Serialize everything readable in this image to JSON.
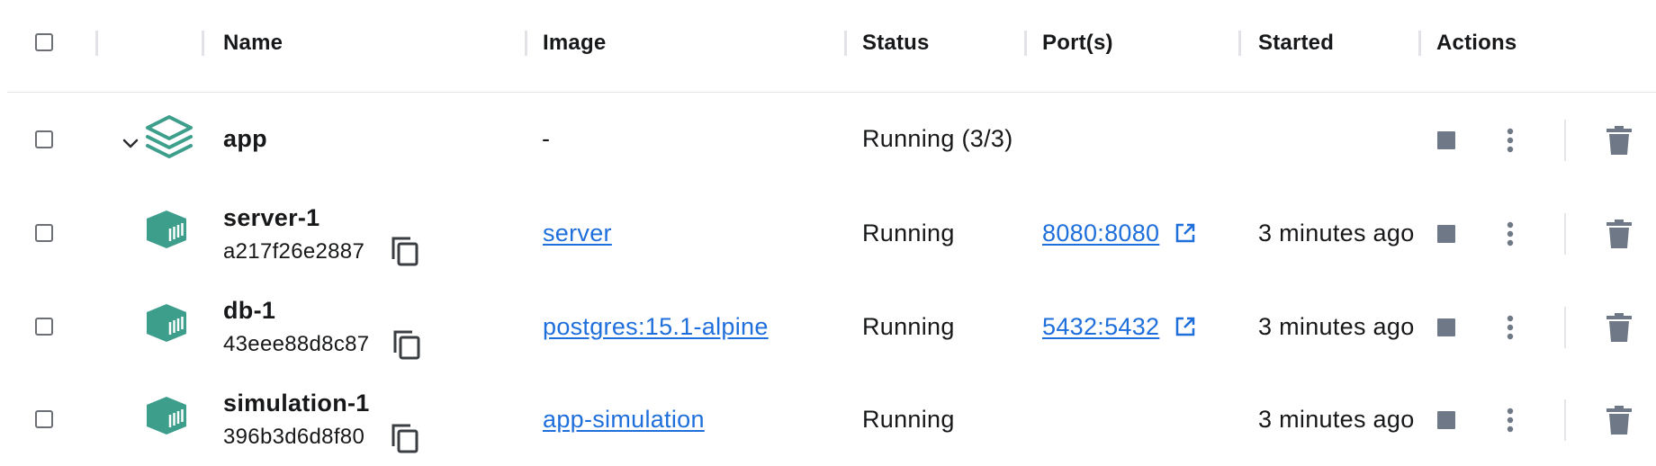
{
  "header": {
    "name": "Name",
    "image": "Image",
    "status": "Status",
    "ports": "Port(s)",
    "started": "Started",
    "actions": "Actions"
  },
  "group": {
    "name": "app",
    "image": "-",
    "status": "Running (3/3)",
    "icon": "stack-icon",
    "expanded": true
  },
  "containers": [
    {
      "name": "server-1",
      "id": "a217f26e2887",
      "image": "server",
      "status": "Running",
      "ports": "8080:8080",
      "started": "3 minutes ago"
    },
    {
      "name": "db-1",
      "id": "43eee88d8c87",
      "image": "postgres:15.1-alpine",
      "status": "Running",
      "ports": "5432:5432",
      "started": "3 minutes ago"
    },
    {
      "name": "simulation-1",
      "id": "396b3d6d8f80",
      "image": "app-simulation",
      "status": "Running",
      "ports": "",
      "started": "3 minutes ago"
    }
  ],
  "colors": {
    "accent": "#3d9e8c",
    "link": "#1e6fdb",
    "icon_gray": "#6f7886"
  }
}
